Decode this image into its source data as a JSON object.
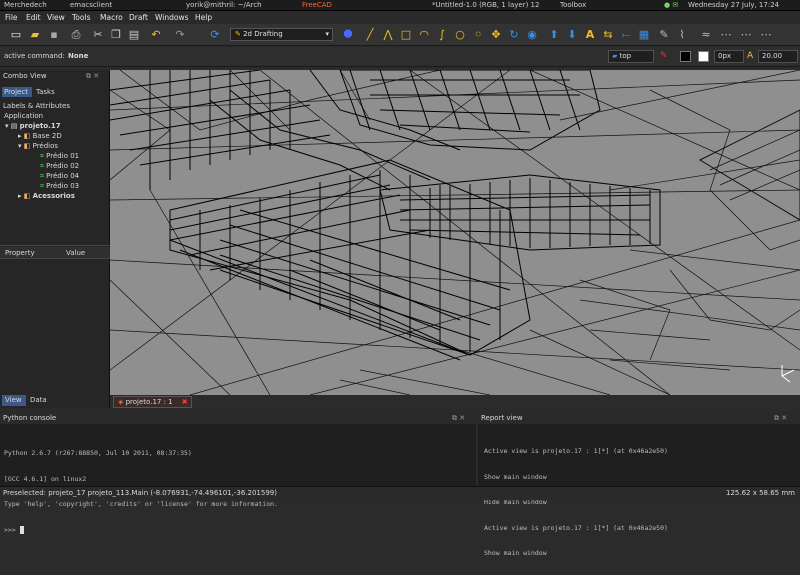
{
  "taskbar": {
    "tasks": [
      "Merchedech",
      "emacsclient",
      "yorik@mithril: ~/Arch",
      "FreeCAD",
      "*Untitled-1.0 (RGB, 1 layer) 12",
      "Toolbox"
    ],
    "clock": "Wednesday 27 July, 17:24"
  },
  "menu": [
    "File",
    "Edit",
    "View",
    "Tools",
    "Macro",
    "Draft",
    "Windows",
    "Help"
  ],
  "workbench": "2d Drafting",
  "command": {
    "label": "active command:",
    "value": "None"
  },
  "draft": {
    "plane": "top",
    "linewidth": "0px",
    "fontsize": "20.00"
  },
  "combo": {
    "title": "Combo View",
    "tabs": [
      "Project",
      "Tasks"
    ],
    "section": "Labels & Attributes",
    "root": "Application",
    "tree": [
      "projeto.17",
      "Base 2D",
      "Prédios",
      "Prédio 01",
      "Prédio 02",
      "Prédio 04",
      "Prédio 03",
      "Acessorios"
    ],
    "prop_headers": [
      "Property",
      "Value"
    ],
    "bottom_tabs": [
      "View",
      "Data"
    ]
  },
  "doc_tab": "projeto.17 : 1",
  "console": {
    "title": "Python console",
    "lines": [
      "Python 2.6.7 (r267:88850, Jul 10 2011, 08:37:35)",
      "[GCC 4.6.1] on linux2",
      "Type 'help', 'copyright', 'credits' or 'license' for more information.",
      ">>> "
    ]
  },
  "report": {
    "title": "Report view",
    "lines": [
      "Active view is projeto.17 : 1[*] (at 0x46a2e50)",
      "Show main window",
      "Hide main window",
      "Active view is projeto.17 : 1[*] (at 0x46a2e50)",
      "Show main window"
    ]
  },
  "status": {
    "left": "Preselected: projeto_17 projeto_113.Main (-8.076931,-74.496101,-36.201599)",
    "right": "125.62 x 58.65 mm"
  },
  "colors": {
    "accent": "#f06a3a",
    "viewport": "#8f8f8f",
    "toolbar_blue": "#3b8ee8",
    "toolbar_yellow": "#f0c020"
  }
}
